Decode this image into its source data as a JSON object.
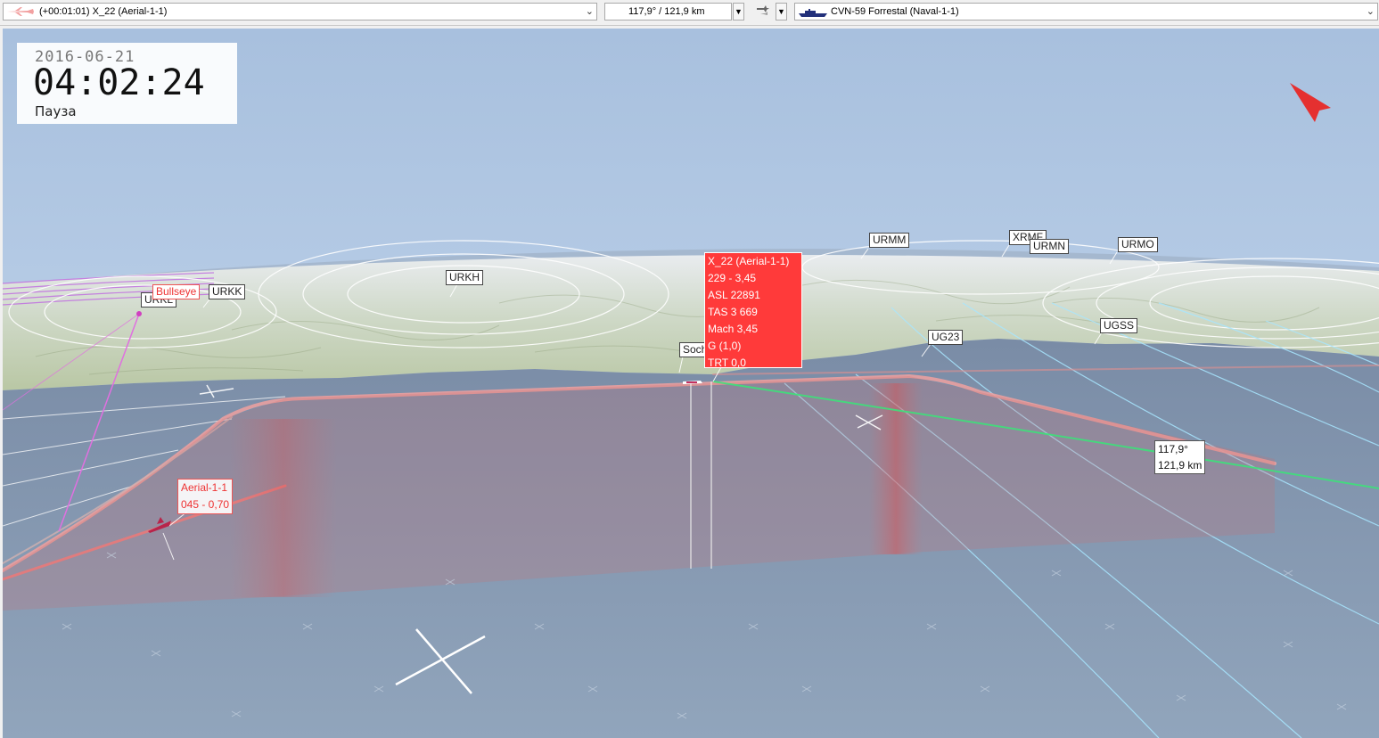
{
  "toolbar": {
    "source_label": "(+00:01:01) X_22 (Aerial-1-1)",
    "bearing_range": "117,9° / 121,9 km",
    "target_label": "CVN-59 Forrestal (Naval-1-1)",
    "source_icon": "aircraft-icon",
    "target_icon": "ship-icon",
    "mode_icon": "aircraft-pair-icon"
  },
  "clock": {
    "date": "2016-06-21",
    "time": "04:02:24",
    "status": "Пауза"
  },
  "airfields": {
    "urkl": "URKL",
    "urkk": "URKK",
    "urkh": "URKH",
    "urmm": "URMM",
    "xrmf": "XRMF",
    "urmn": "URMN",
    "urmo": "URMO",
    "sochi": "Sochi",
    "ug23": "UG23",
    "ugss": "UGSS"
  },
  "bullseye": "Bullseye",
  "info": {
    "name": "X_22 (Aerial-1-1)",
    "hdg_mach": "229 - 3,45",
    "asl": "ASL 22891",
    "tas": "TAS 3 669",
    "mach": "Mach 3,45",
    "g": "G (1,0)",
    "trt": "TRT 0,0"
  },
  "aerial": {
    "name": "Aerial-1-1",
    "hdg_mach": "045 - 0,70"
  },
  "bearing_box": {
    "bearing": "117,9°",
    "range": "121,9 km"
  },
  "colors": {
    "accent_red": "#ff3a3a",
    "track_pink": "#f0a0a0",
    "bearing_green": "#4ce08a",
    "sky": "#b8cee8",
    "sea": "#8c9fb6"
  }
}
